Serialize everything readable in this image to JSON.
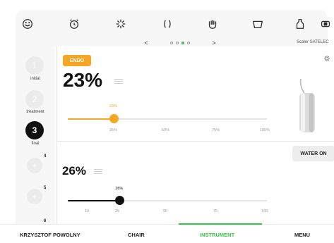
{
  "top_icons": [
    "face-icon",
    "alarm-clock-icon",
    "light-burst-icon",
    "bracket-icon",
    "hand-icon",
    "tray-icon",
    "bottle-icon",
    "toggle-icon"
  ],
  "pager": {
    "prev": "<",
    "next": ">",
    "dots": 4,
    "active_dot": 2
  },
  "scaler_label": "Scaler SATELEC",
  "steps": [
    {
      "num": "1",
      "label": "initial",
      "active": false
    },
    {
      "num": "2",
      "label": "treatment",
      "active": false
    },
    {
      "num": "3",
      "label": "final",
      "active": true
    },
    {
      "num": "4",
      "label": "",
      "active": false
    },
    {
      "num": "5",
      "label": "",
      "active": false
    },
    {
      "num": "6",
      "label": "",
      "active": false
    }
  ],
  "power": {
    "mode": "ENDO",
    "value": "23%",
    "level": 23,
    "knob_label": "23%",
    "ticks": [
      "25%",
      "50%",
      "75%",
      "100%"
    ],
    "accent": "#f5a623"
  },
  "water": {
    "value": "26%",
    "level": 26,
    "knob_label": "26%",
    "ticks": [
      "10",
      "25",
      "50",
      "75",
      "100"
    ],
    "badge": "WATER ON",
    "accent": "#111111"
  },
  "bottom_nav": {
    "user": "KRZYSZTOF POWOLNY",
    "chair": "CHAIR",
    "instrument": "INSTRUMENT",
    "menu": "MENU",
    "active_color": "#35c84a"
  }
}
